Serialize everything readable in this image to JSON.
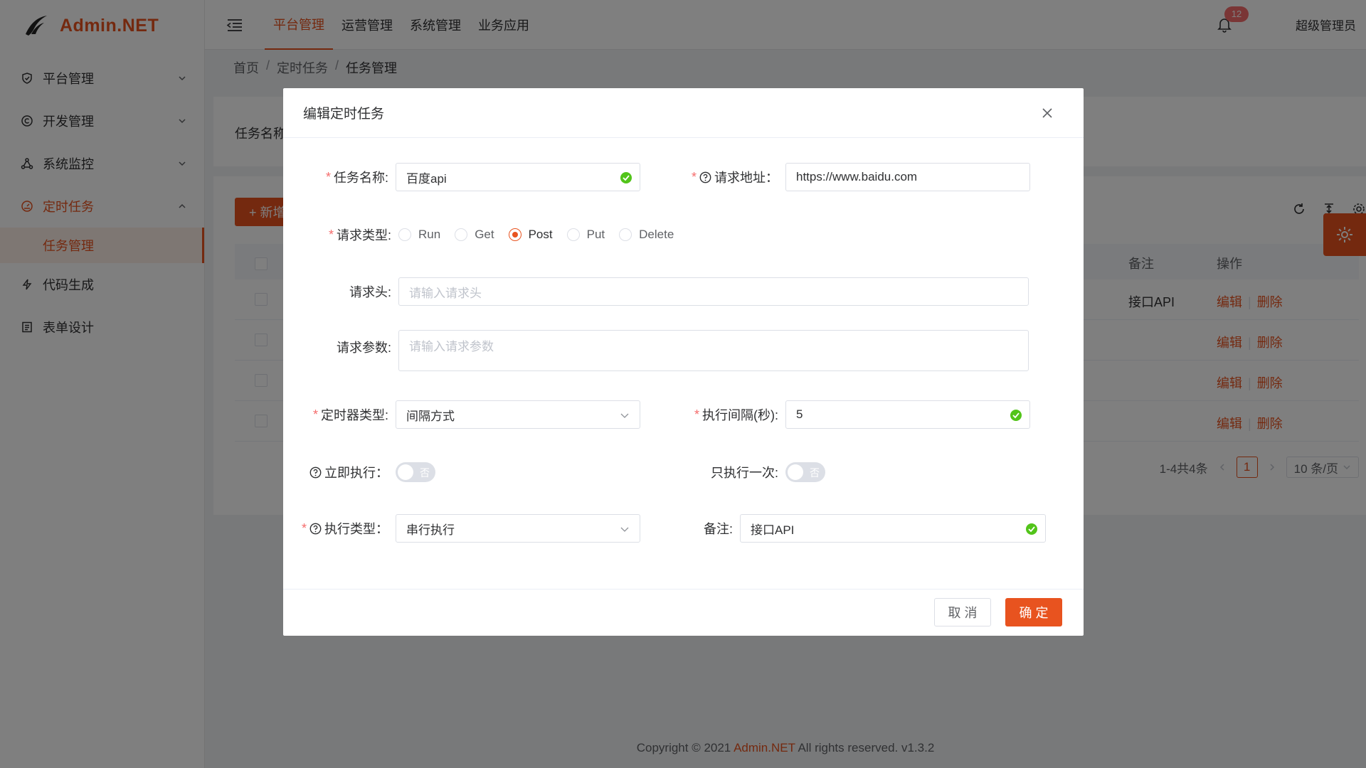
{
  "app": {
    "logo_text": "Admin.NET"
  },
  "sidebar": {
    "items": [
      {
        "label": "平台管理",
        "icon": "shield-icon"
      },
      {
        "label": "开发管理",
        "icon": "copyright-icon"
      },
      {
        "label": "系统监控",
        "icon": "cluster-icon"
      },
      {
        "label": "定时任务",
        "icon": "dashboard-icon"
      },
      {
        "label": "代码生成",
        "icon": "thunder-icon"
      },
      {
        "label": "表单设计",
        "icon": "form-icon"
      }
    ],
    "active_sub": "任务管理"
  },
  "header": {
    "tabs": [
      "平台管理",
      "运营管理",
      "系统管理",
      "业务应用"
    ],
    "notify_count": "12",
    "username": "超级管理员"
  },
  "breadcrumb": [
    "首页",
    "定时任务",
    "任务管理"
  ],
  "background": {
    "search_label": "任务名称",
    "add_button": "+ 新增",
    "columns": {
      "remark": "备注",
      "ops": "操作"
    },
    "rows": [
      {
        "remark": "接口API",
        "edit": "编辑",
        "delete": "删除"
      },
      {
        "remark": "",
        "edit": "编辑",
        "delete": "删除"
      },
      {
        "remark": "",
        "edit": "编辑",
        "delete": "删除"
      },
      {
        "remark": "",
        "edit": "编辑",
        "delete": "删除"
      }
    ],
    "pager": {
      "total": "1-4共4条",
      "current": "1",
      "page_size": "10 条/页"
    }
  },
  "dialog": {
    "title": "编辑定时任务",
    "fields": {
      "job_name": {
        "label": "任务名称:",
        "value": "百度api"
      },
      "request_url": {
        "label": "请求地址：",
        "value": "https://www.baidu.com"
      },
      "request_type": {
        "label": "请求类型:",
        "options": [
          "Run",
          "Get",
          "Post",
          "Put",
          "Delete"
        ],
        "selected": "Post"
      },
      "headers": {
        "label": "请求头:",
        "placeholder": "请输入请求头"
      },
      "params": {
        "label": "请求参数:",
        "placeholder": "请输入请求参数"
      },
      "timer_type": {
        "label": "定时器类型:",
        "value": "间隔方式"
      },
      "interval": {
        "label": "执行间隔(秒):",
        "value": "5"
      },
      "run_now": {
        "label": "立即执行：",
        "state": "否"
      },
      "run_once": {
        "label": "只执行一次:",
        "state": "否"
      },
      "exec_type": {
        "label": "执行类型：",
        "value": "串行执行"
      },
      "remark": {
        "label": "备注:",
        "value": "接口API"
      }
    },
    "cancel_label": "取 消",
    "ok_label": "确 定"
  },
  "footer": {
    "prefix": "Copyright © 2021",
    "brand": "Admin.NET",
    "suffix": "All rights reserved. v1.3.2"
  },
  "colors": {
    "accent": "#e8531f",
    "success": "#52c41a",
    "required": "#f56c6c"
  }
}
